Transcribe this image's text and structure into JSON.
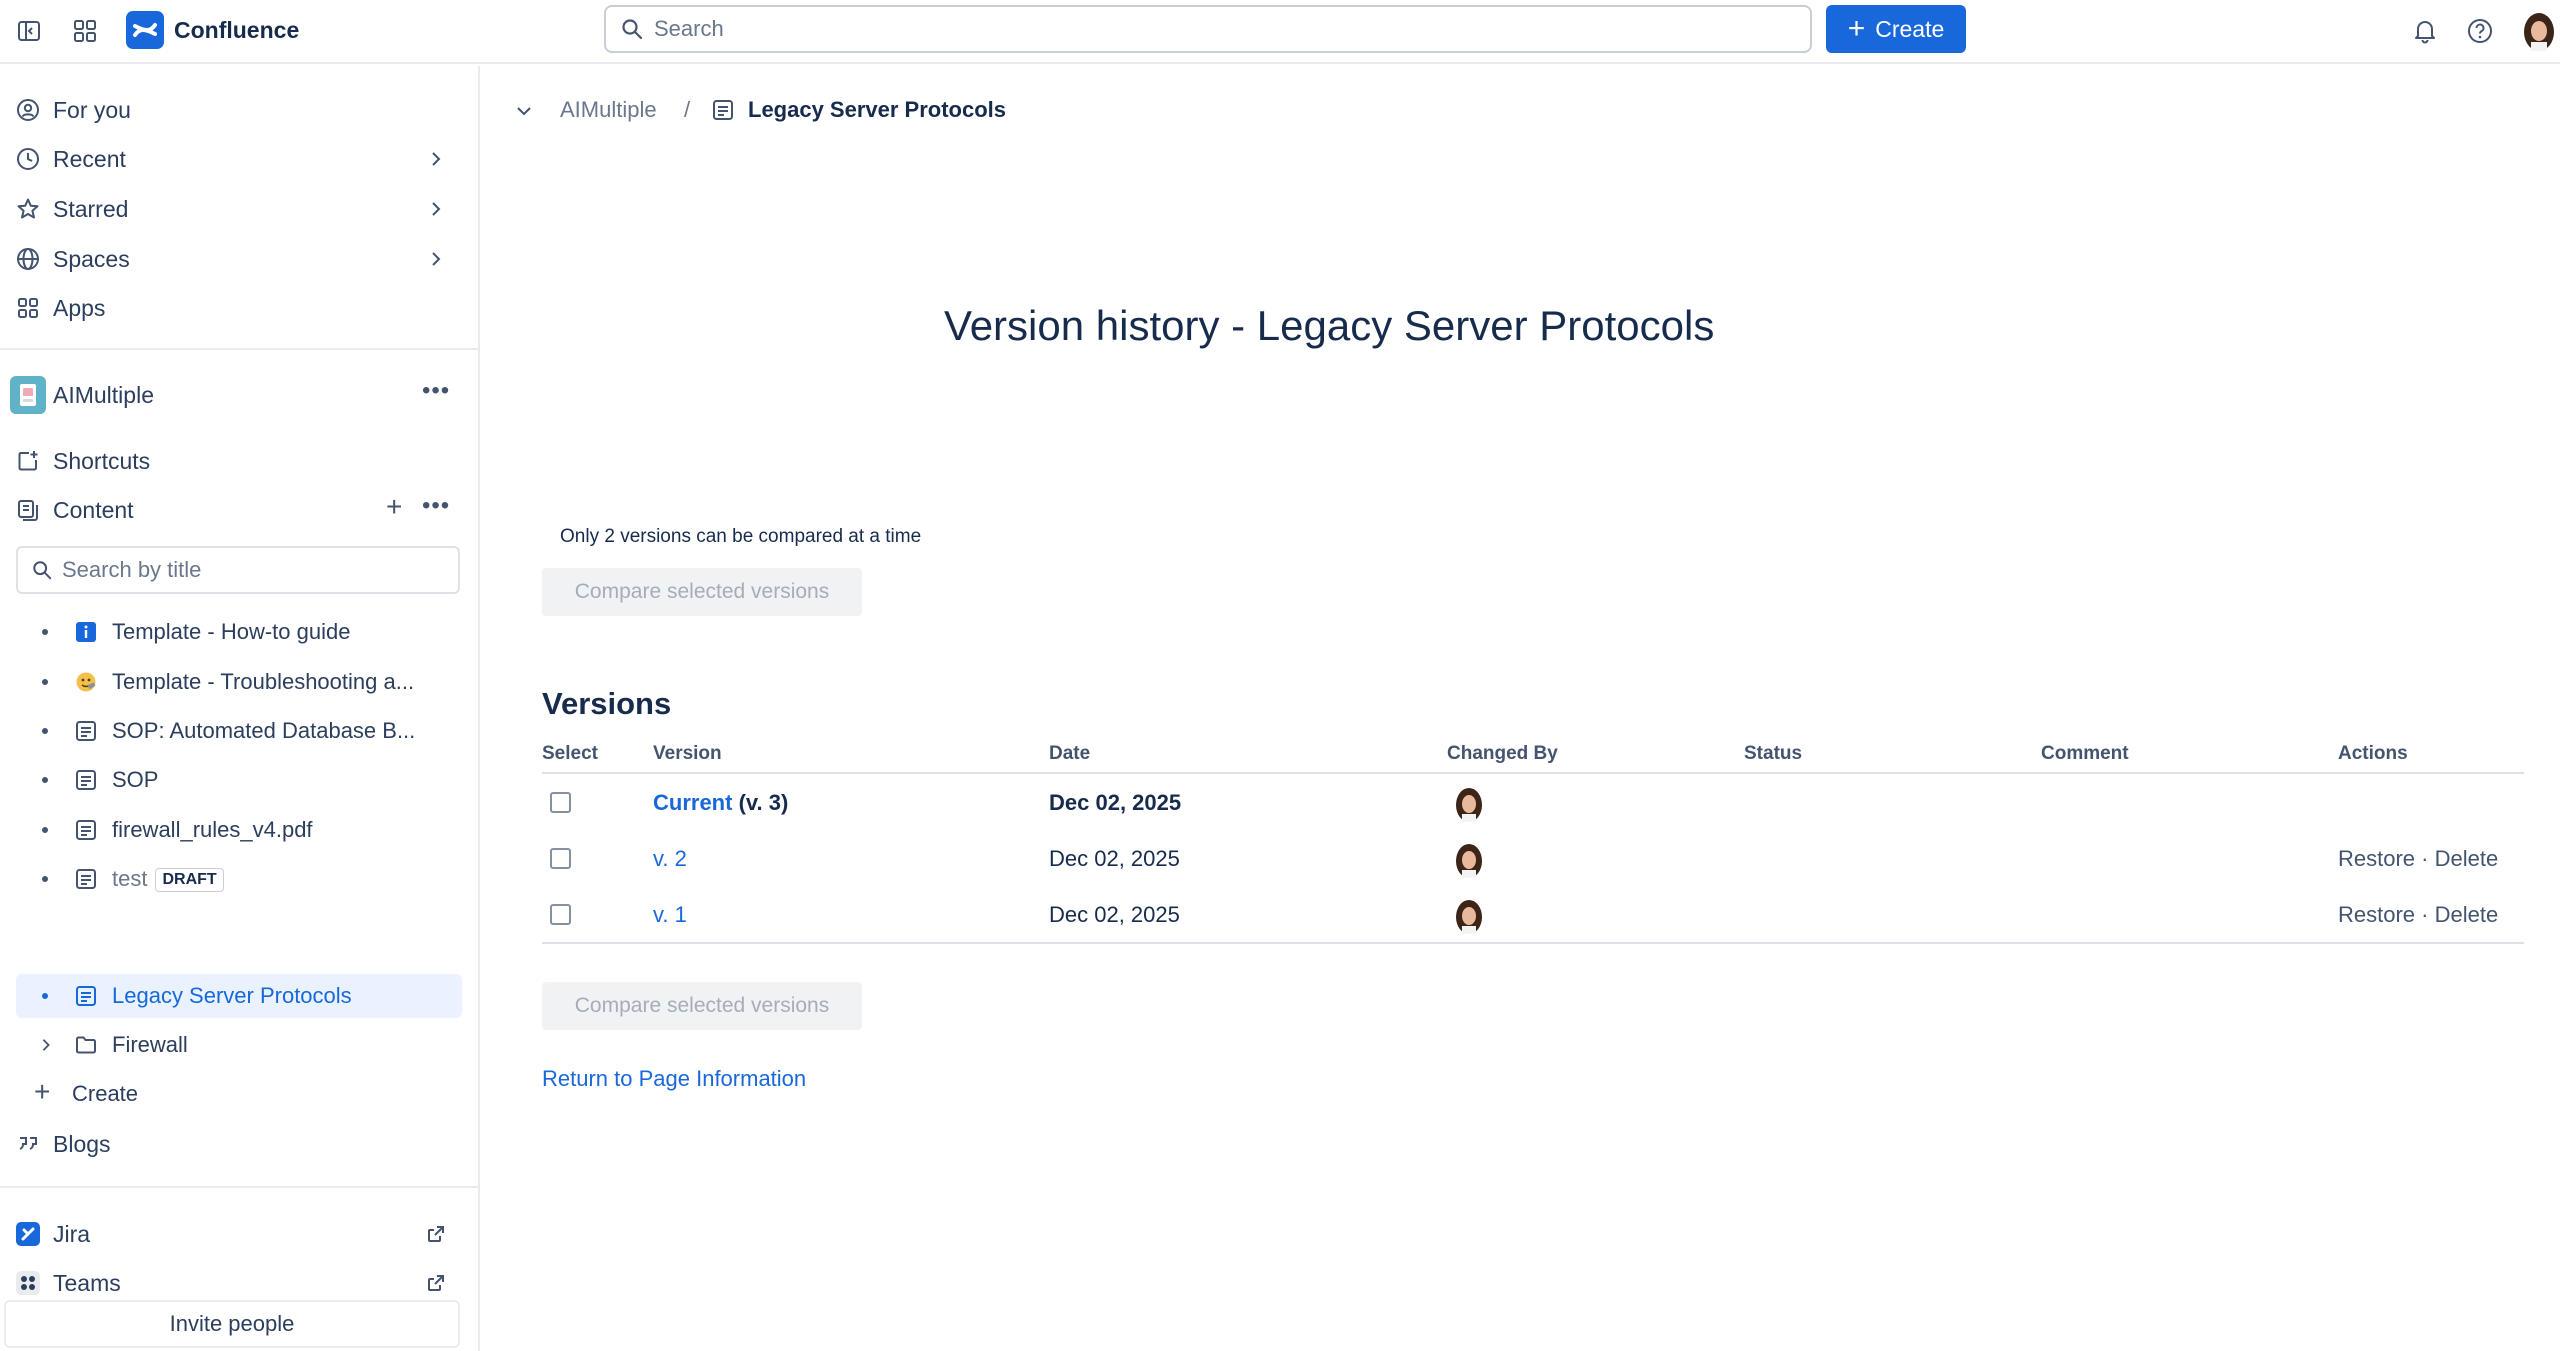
{
  "topbar": {
    "app_name": "Confluence",
    "search_placeholder": "Search",
    "create_label": "Create",
    "icons": [
      "sidebar-toggle-icon",
      "app-switcher-icon",
      "confluence-logo-icon",
      "search-icon",
      "bell-icon",
      "help-icon",
      "avatar"
    ]
  },
  "sidebar": {
    "nav": [
      {
        "label": "For you",
        "icon": "person-circle-icon"
      },
      {
        "label": "Recent",
        "icon": "clock-icon"
      },
      {
        "label": "Starred",
        "icon": "star-icon"
      },
      {
        "label": "Spaces",
        "icon": "globe-icon"
      },
      {
        "label": "Apps",
        "icon": "apps-icon"
      }
    ],
    "space_name": "AIMultiple",
    "shortcuts_label": "Shortcuts",
    "content_label": "Content",
    "search_placeholder": "Search by title",
    "tree": [
      {
        "label": "Template - How-to guide",
        "icon": "info-square-icon"
      },
      {
        "label": "Template - Troubleshooting a...",
        "icon": "emoji-icon"
      },
      {
        "label": "SOP: Automated Database B...",
        "icon": "page-icon"
      },
      {
        "label": "SOP",
        "icon": "page-icon"
      },
      {
        "label": "firewall_rules_v4.pdf",
        "icon": "page-icon"
      },
      {
        "label": "test",
        "badge": "DRAFT",
        "icon": "page-icon"
      },
      {
        "label": "Legacy Server Protocols",
        "icon": "page-icon",
        "selected": true
      },
      {
        "label": "Firewall",
        "icon": "folder-icon"
      }
    ],
    "create_label": "Create",
    "blogs_label": "Blogs",
    "apps": [
      {
        "label": "Jira",
        "icon": "jira-icon"
      },
      {
        "label": "Teams",
        "icon": "teams-icon"
      }
    ],
    "invite_label": "Invite people"
  },
  "breadcrumb": {
    "space": "AIMultiple",
    "separator": "/",
    "page": "Legacy Server Protocols"
  },
  "main": {
    "title": "Version history - Legacy Server Protocols",
    "compare_note": "Only 2 versions can be compared at a time",
    "compare_button": "Compare selected versions",
    "versions_heading": "Versions",
    "columns": [
      "Select",
      "Version",
      "Date",
      "Changed By",
      "Status",
      "Comment",
      "Actions"
    ],
    "rows": [
      {
        "version_link": "Current",
        "version_suffix": " (v. 3)",
        "date": "Dec 02, 2025",
        "bold": true,
        "actions": ""
      },
      {
        "version_link": "v. 2",
        "version_suffix": "",
        "date": "Dec 02, 2025",
        "bold": false,
        "actions": "Restore · Delete"
      },
      {
        "version_link": "v. 1",
        "version_suffix": "",
        "date": "Dec 02, 2025",
        "bold": false,
        "actions": "Restore · Delete"
      }
    ],
    "return_link": "Return to Page Information"
  },
  "colors": {
    "brand": "#1868db",
    "selected_bg": "#e9f2fe",
    "text": "#172b4d",
    "muted": "#6b778c"
  }
}
